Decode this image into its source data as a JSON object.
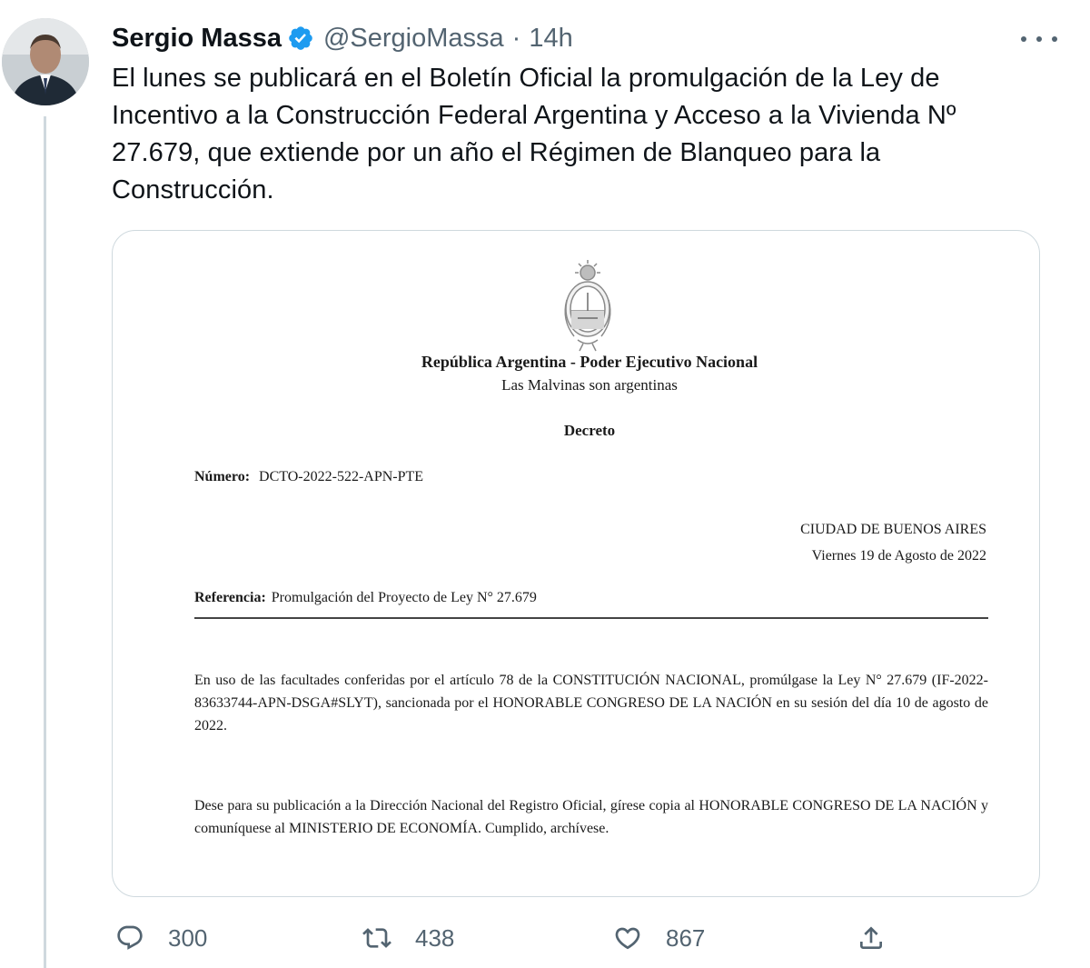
{
  "tweet": {
    "author_name": "Sergio Massa",
    "handle": "@SergioMassa",
    "separator": "·",
    "time": "14h",
    "text": "El lunes se publicará en el Boletín Oficial la promulgación de la Ley de Incentivo a la Construcción Federal Argentina y Acceso a la Vivienda Nº 27.679, que extiende por un año el Régimen de Blanqueo para la Construcción."
  },
  "document": {
    "title": "República Argentina - Poder Ejecutivo Nacional",
    "motto": "Las Malvinas son argentinas",
    "type": "Decreto",
    "number_label": "Número:",
    "number_value": "DCTO-2022-522-APN-PTE",
    "city": "CIUDAD DE BUENOS AIRES",
    "date": "Viernes 19 de Agosto de 2022",
    "reference_label": "Referencia:",
    "reference_value": "Promulgación del Proyecto de Ley N° 27.679",
    "paragraph_1": "En uso de las facultades conferidas por el artículo 78 de la CONSTITUCIÓN NACIONAL, promúlgase la Ley N° 27.679 (IF-2022-83633744-APN-DSGA#SLYT), sancionada por el HONORABLE CONGRESO DE LA NACIÓN en su sesión del día 10 de agosto de 2022.",
    "paragraph_2": "Dese para su publicación a la Dirección Nacional del Registro Oficial, gírese copia al HONORABLE CONGRESO DE LA NACIÓN y comuníquese al MINISTERIO DE ECONOMÍA. Cumplido, archívese."
  },
  "actions": {
    "replies": "300",
    "retweets": "438",
    "likes": "867"
  },
  "icons": {
    "verified": "verified-badge-icon",
    "more": "more-options-icon",
    "reply": "reply-icon",
    "retweet": "retweet-icon",
    "like": "heart-icon",
    "share": "share-icon"
  },
  "colors": {
    "verified": "#1d9bf0",
    "secondary_text": "#536471",
    "primary_text": "#0f1419",
    "border": "#cfd9de"
  }
}
